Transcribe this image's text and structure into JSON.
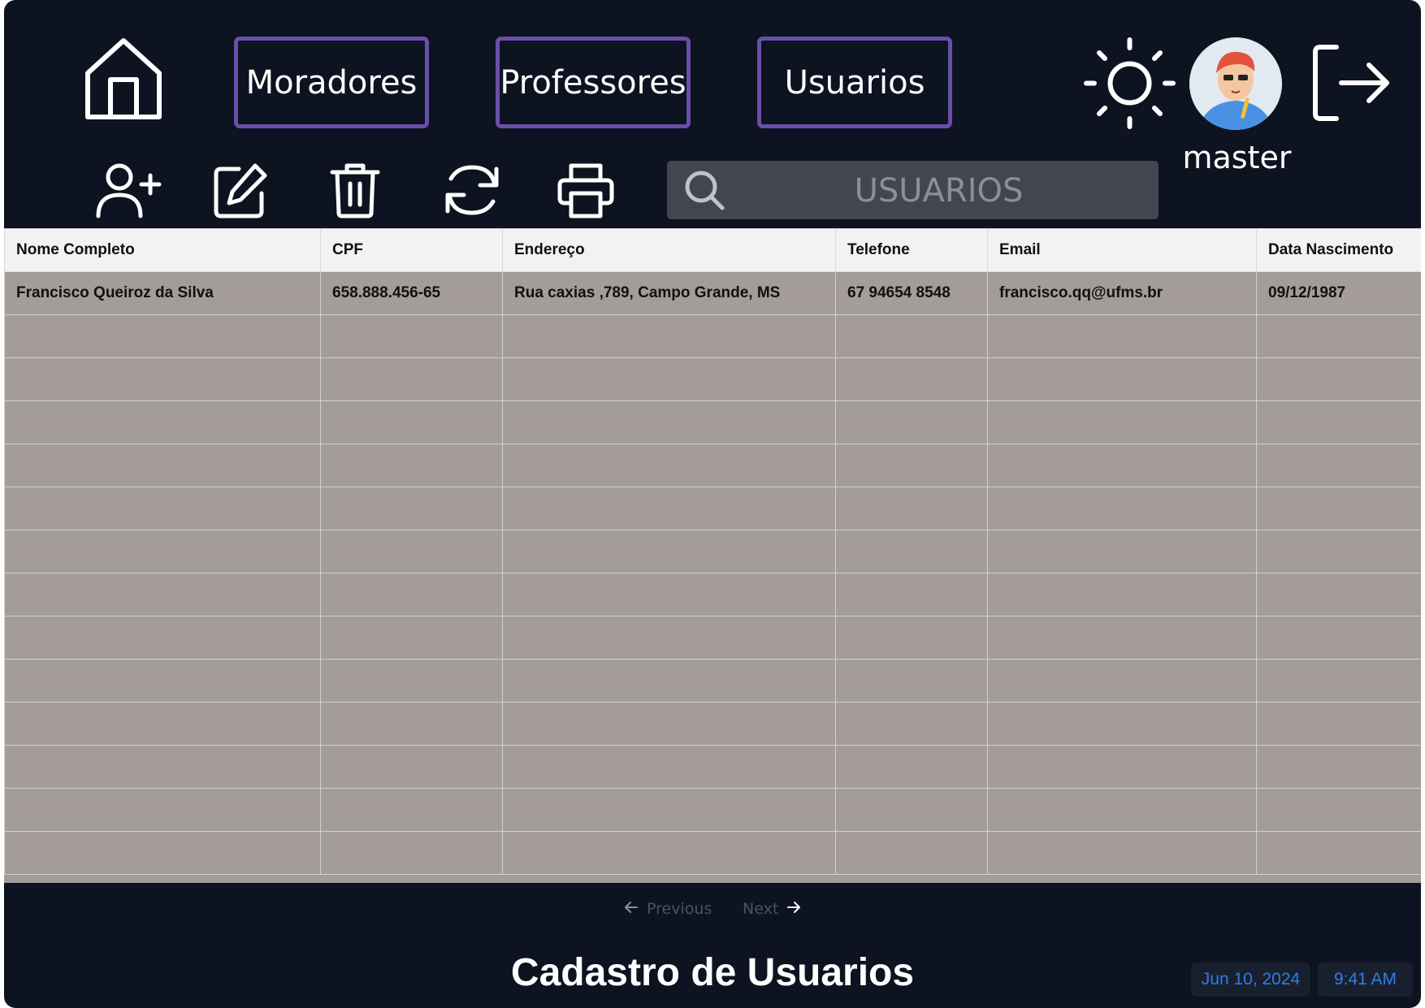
{
  "nav": {
    "tabs": [
      {
        "label": "Moradores"
      },
      {
        "label": "Professores"
      },
      {
        "label": "Usuarios"
      }
    ]
  },
  "search": {
    "placeholder": "USUARIOS"
  },
  "user": {
    "name": "master"
  },
  "icons": {
    "home": "home-icon",
    "theme": "sun-icon",
    "logout": "logout-icon",
    "add_user": "user-plus-icon",
    "edit": "edit-icon",
    "delete": "trash-icon",
    "refresh": "refresh-icon",
    "print": "printer-icon"
  },
  "table": {
    "columns": [
      "Nome Completo",
      "CPF",
      "Endereço",
      "Telefone",
      "Email",
      "Data Nascimento"
    ],
    "rows": [
      [
        "Francisco Queiroz da Silva",
        "658.888.456-65",
        "Rua caxias  ,789, Campo Grande, MS",
        "67 94654 8548",
        "francisco.qq@ufms.br",
        "09/12/1987"
      ],
      [
        "",
        "",
        "",
        "",
        "",
        ""
      ],
      [
        "",
        "",
        "",
        "",
        "",
        ""
      ],
      [
        "",
        "",
        "",
        "",
        "",
        ""
      ],
      [
        "",
        "",
        "",
        "",
        "",
        ""
      ],
      [
        "",
        "",
        "",
        "",
        "",
        ""
      ],
      [
        "",
        "",
        "",
        "",
        "",
        ""
      ],
      [
        "",
        "",
        "",
        "",
        "",
        ""
      ],
      [
        "",
        "",
        "",
        "",
        "",
        ""
      ],
      [
        "",
        "",
        "",
        "",
        "",
        ""
      ],
      [
        "",
        "",
        "",
        "",
        "",
        ""
      ],
      [
        "",
        "",
        "",
        "",
        "",
        ""
      ],
      [
        "",
        "",
        "",
        "",
        "",
        ""
      ],
      [
        "",
        "",
        "",
        "",
        "",
        ""
      ]
    ]
  },
  "pagination": {
    "previous": "Previous",
    "next": "Next"
  },
  "footer": {
    "title": "Cadastro de Usuarios",
    "date": "Jun 10, 2024",
    "time": "9:41 AM"
  },
  "colors": {
    "background": "#0d1320",
    "tab_border": "#6a4fa8",
    "table_row": "#a39c99",
    "accent_blue": "#2f7ee6"
  }
}
